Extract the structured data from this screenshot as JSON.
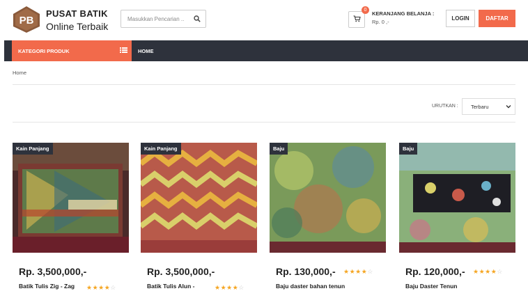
{
  "brand": {
    "logo_text": "PB",
    "line1": "PUSAT BATIK",
    "line2": "Online Terbaik"
  },
  "search": {
    "placeholder": "Masukkan Pencarian ..",
    "value": ""
  },
  "cart": {
    "count": "0",
    "title": "KERANJANG BELANJA :",
    "total": "Rp. 0 ,-"
  },
  "auth": {
    "login": "LOGIN",
    "register": "DAFTAR"
  },
  "nav": {
    "category": "KATEGORI PRODUK",
    "home": "HOME"
  },
  "breadcrumb": "Home",
  "sort": {
    "label": "URUTKAN :",
    "selected": "Terbaru"
  },
  "colors": {
    "accent": "#f26a4b",
    "navbar": "#2e323c",
    "star": "#f5a623"
  },
  "products": [
    {
      "badge": "Kain Panjang",
      "price": "Rp. 3,500,000,-",
      "name": "Batik Tulis Zig - Zag",
      "rating": 4
    },
    {
      "badge": "Kain Panjang",
      "price": "Rp. 3,500,000,-",
      "name": "Batik Tulis Alun -",
      "rating": 4
    },
    {
      "badge": "Baju",
      "price": "Rp. 130,000,-",
      "name": "Baju daster bahan tenun",
      "rating": 4
    },
    {
      "badge": "Baju",
      "price": "Rp. 120,000,-",
      "name": "Baju Daster Tenun",
      "rating": 4
    }
  ]
}
